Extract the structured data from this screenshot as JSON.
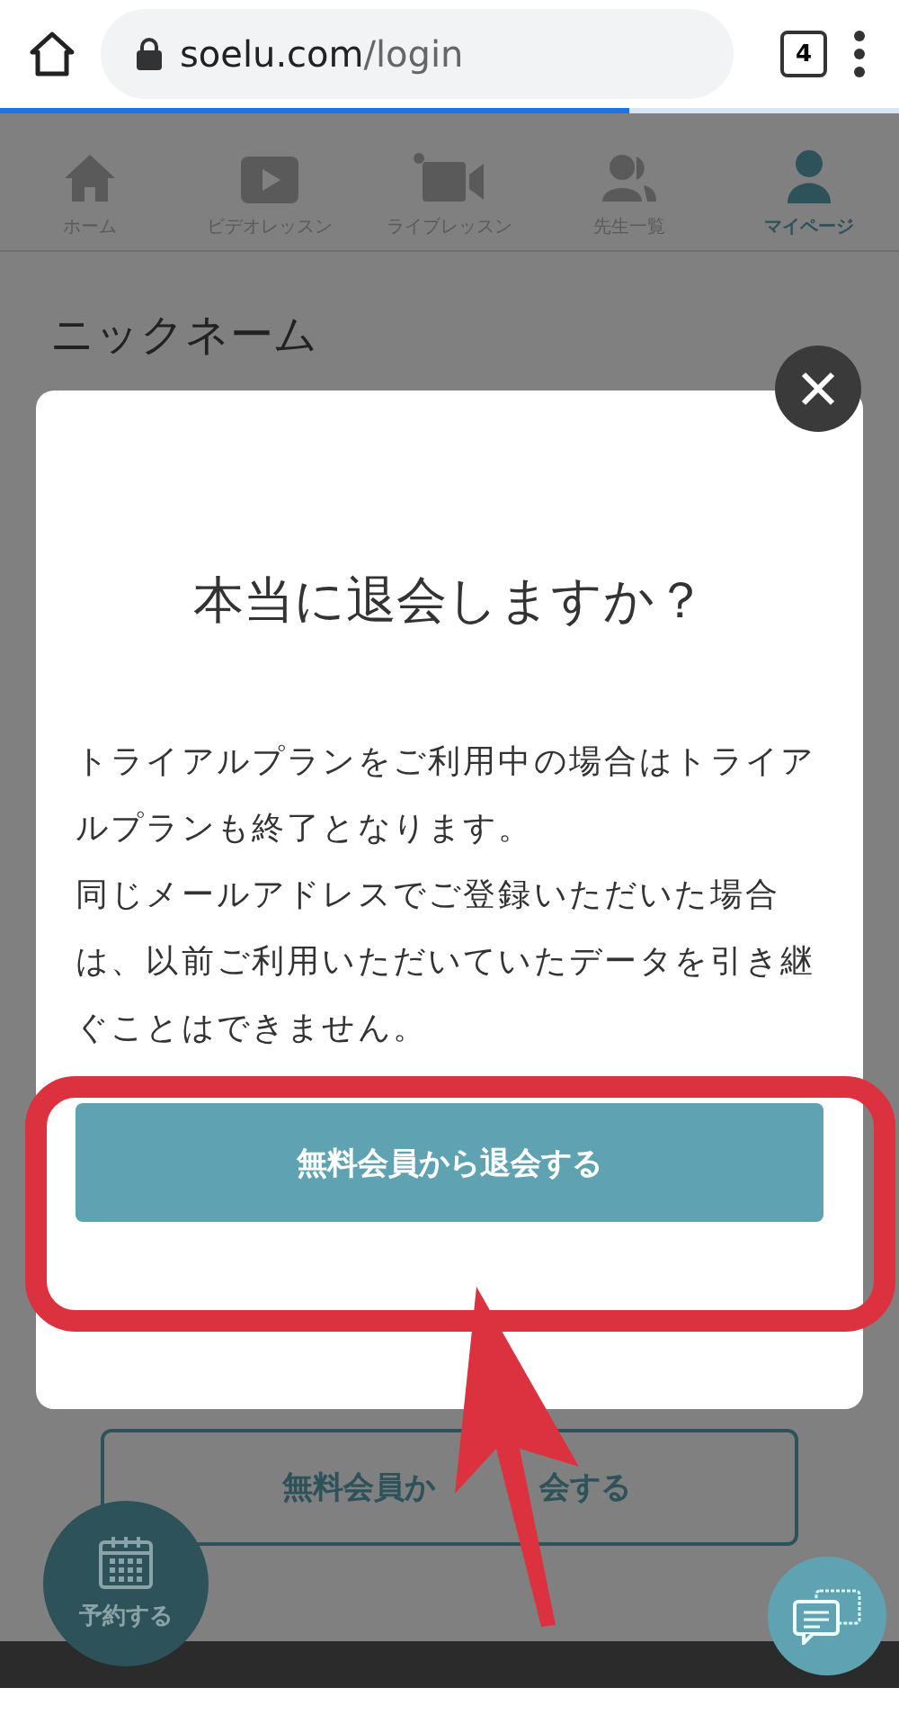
{
  "browser": {
    "url_domain": "soelu.com",
    "url_path": "/login",
    "tab_count": "4",
    "progress": {
      "level": 0.7
    }
  },
  "nav": [
    {
      "label": "ホーム",
      "selected": false
    },
    {
      "label": "ビデオレッスン",
      "selected": false
    },
    {
      "label": "ライブレッスン",
      "selected": false
    },
    {
      "label": "先生一覧",
      "selected": false
    },
    {
      "label": "マイページ",
      "selected": true
    }
  ],
  "page": {
    "heading": "ニックネーム",
    "withdraw_button_parts": [
      "無料会員か",
      "会する"
    ],
    "reserve_button": "予約する"
  },
  "modal": {
    "title": "本当に退会しますか？",
    "paragraphs": [
      "トライアルプランをご利用中の場合はトライアルプランも終了となります。",
      "同じメールアドレスでご登録いただいた場合は、以前ご利用いただいていたデータを引き継ぐことはできません。"
    ],
    "confirm_button": "無料会員から退会する"
  }
}
